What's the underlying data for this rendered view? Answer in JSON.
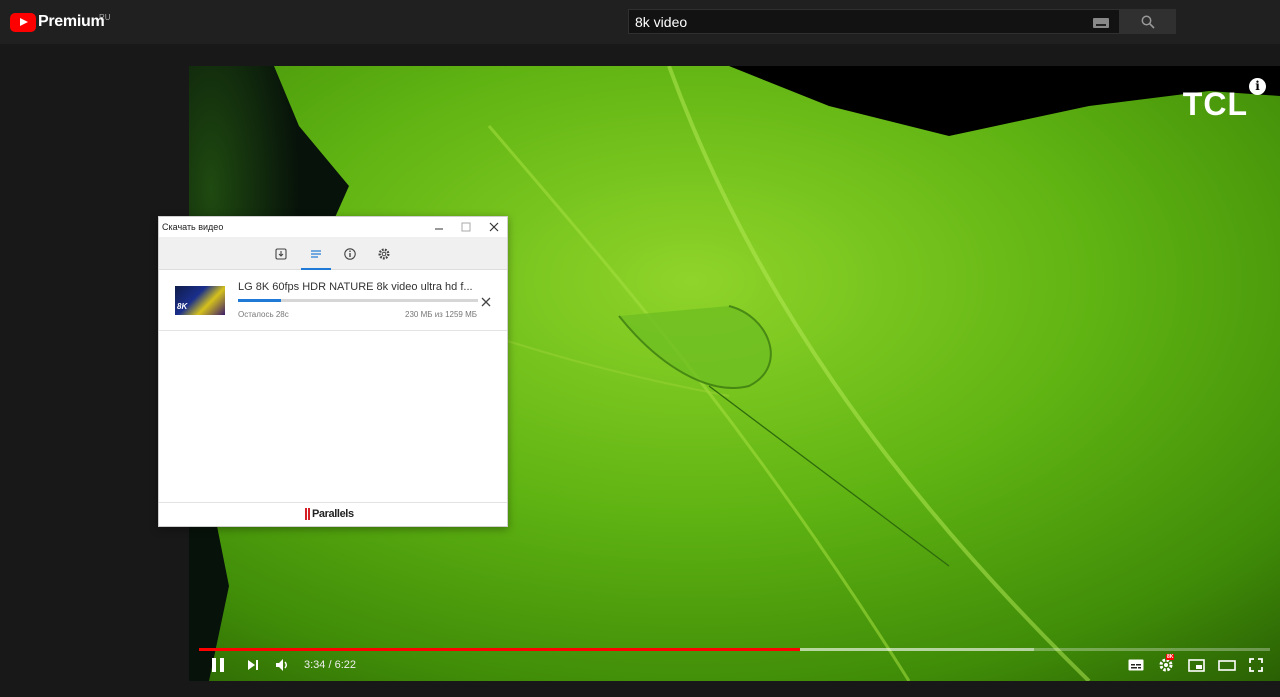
{
  "header": {
    "logo_text": "Premium",
    "logo_region": "RU",
    "search_value": "8k video"
  },
  "video": {
    "brand_logo": "TCL",
    "info_label": "i",
    "current_time": "3:34",
    "duration": "6:22",
    "time_display": "3:34 / 6:22",
    "played_fraction": 0.561,
    "buffered_fraction": 0.78,
    "settings_badge": "8K",
    "progress_color": "#ff0000"
  },
  "dialog": {
    "title": "Скачать видео",
    "toolbar_icons": [
      "download-icon",
      "list-icon",
      "info-icon",
      "gear-icon"
    ],
    "active_tab": 1,
    "download": {
      "title": "LG 8K 60fps HDR NATURE 8k video ultra hd f...",
      "thumb_label": "8K",
      "progress_fraction": 0.18,
      "remaining": "Осталось 28с",
      "size": "230 МБ из 1259 МБ"
    },
    "footer_brand": "Parallels",
    "accent_color": "#1e7ad6"
  }
}
